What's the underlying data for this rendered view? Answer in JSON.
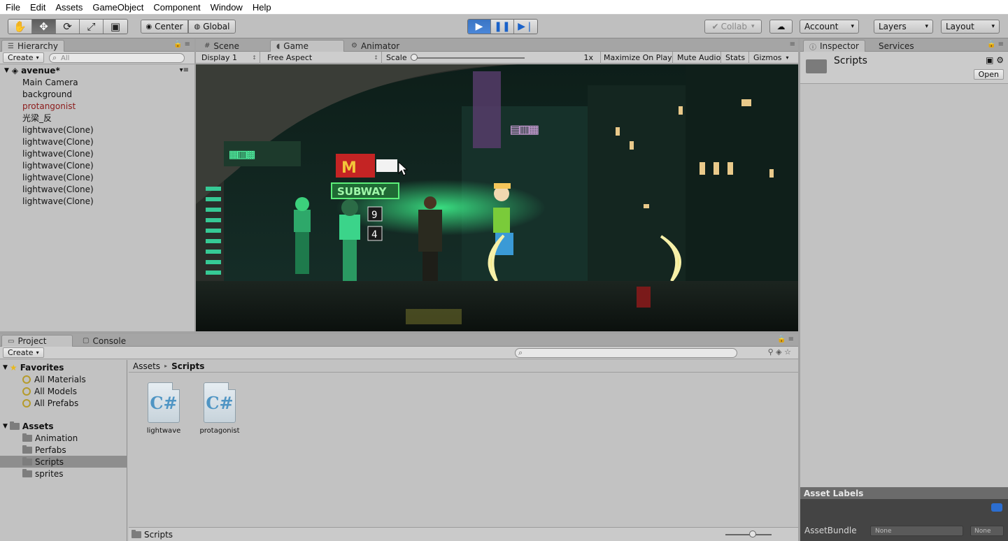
{
  "menubar": {
    "items": [
      "File",
      "Edit",
      "Assets",
      "GameObject",
      "Component",
      "Window",
      "Help"
    ]
  },
  "toolbar": {
    "tools": [
      "hand-tool",
      "move-tool",
      "rotate-tool",
      "scale-tool",
      "rect-tool"
    ],
    "active_tool": "move-tool",
    "pivot_center": "Center",
    "pivot_global": "Global",
    "play_state": "playing",
    "collab": "Collab",
    "account": "Account",
    "layers": "Layers",
    "layout": "Layout"
  },
  "hierarchy": {
    "tab": "Hierarchy",
    "create": "Create",
    "search_placeholder": "All",
    "scene": "avenue*",
    "items": [
      {
        "label": "Main Camera",
        "color": "#111111"
      },
      {
        "label": "background",
        "color": "#111111"
      },
      {
        "label": "protangonist",
        "color": "#8c1a1a"
      },
      {
        "label": "光梁_反",
        "color": "#111111"
      },
      {
        "label": "lightwave(Clone)",
        "color": "#111111"
      },
      {
        "label": "lightwave(Clone)",
        "color": "#111111"
      },
      {
        "label": "lightwave(Clone)",
        "color": "#111111"
      },
      {
        "label": "lightwave(Clone)",
        "color": "#111111"
      },
      {
        "label": "lightwave(Clone)",
        "color": "#111111"
      },
      {
        "label": "lightwave(Clone)",
        "color": "#111111"
      },
      {
        "label": "lightwave(Clone)",
        "color": "#111111"
      }
    ]
  },
  "center_tabs": [
    "Scene",
    "Game",
    "Animator"
  ],
  "game_toolbar": {
    "display": "Display 1",
    "aspect": "Free Aspect",
    "scale_label": "Scale",
    "scale_value": "1x",
    "maximize": "Maximize On Play",
    "mute": "Mute Audio",
    "stats": "Stats",
    "gizmos": "Gizmos"
  },
  "game_view": {
    "signs": [
      "SUBWAY"
    ],
    "numbers": [
      "9",
      "4"
    ]
  },
  "inspector": {
    "tab": "Inspector",
    "services_tab": "Services",
    "title": "Scripts",
    "open": "Open",
    "asset_labels": "Asset Labels",
    "asset_bundle_label": "AssetBundle",
    "asset_bundle_value": "None",
    "asset_bundle_variant": "None"
  },
  "project": {
    "tab": "Project",
    "console_tab": "Console",
    "create": "Create",
    "favorites_label": "Favorites",
    "favorites": [
      "All Materials",
      "All Models",
      "All Prefabs"
    ],
    "assets_label": "Assets",
    "folders": [
      "Animation",
      "Perfabs",
      "Scripts",
      "sprites"
    ],
    "selected_folder": "Scripts",
    "breadcrumb_root": "Assets",
    "breadcrumb_current": "Scripts",
    "files": [
      "lightwave",
      "protagonist"
    ],
    "footer_path": "Scripts"
  }
}
